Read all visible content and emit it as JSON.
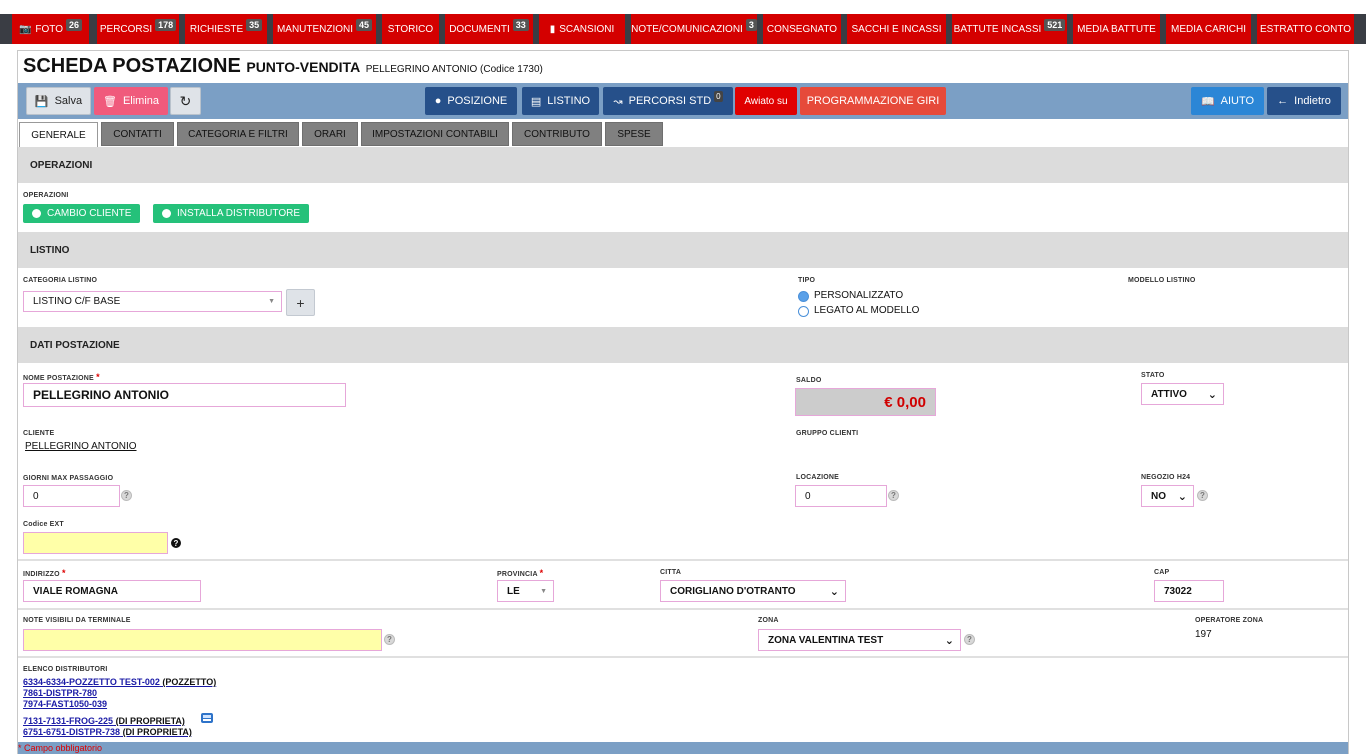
{
  "menu": [
    {
      "label": "FOTO",
      "badge": "26",
      "icon": "camera-icon"
    },
    {
      "label": "PERCORSI",
      "badge": "178"
    },
    {
      "label": "RICHIESTE",
      "badge": "35"
    },
    {
      "label": "MANUTENZIONI",
      "badge": "45"
    },
    {
      "label": "STORICO",
      "badge": ""
    },
    {
      "label": "DOCUMENTI",
      "badge": "33"
    },
    {
      "label": "SCANSIONI",
      "badge": "",
      "icon": "folder-icon"
    },
    {
      "label": "NOTE/COMUNICAZIONI",
      "badge": "3"
    },
    {
      "label": "CONSEGNATO",
      "badge": ""
    },
    {
      "label": "SACCHI E INCASSI",
      "badge": ""
    },
    {
      "label": "BATTUTE INCASSI",
      "badge": "521"
    },
    {
      "label": "MEDIA BATTUTE",
      "badge": ""
    },
    {
      "label": "MEDIA CARICHI",
      "badge": ""
    },
    {
      "label": "ESTRATTO CONTO",
      "badge": ""
    }
  ],
  "header": {
    "title": "SCHEDA POSTAZIONE",
    "subtitle": "PUNTO-VENDITA",
    "detail": "PELLEGRINO ANTONIO (Codice 1730)"
  },
  "toolbar": {
    "save": "Salva",
    "delete": "Elimina",
    "position": "POSIZIONE",
    "listino": "LISTINO",
    "percorsi_std": "PERCORSI STD",
    "percorsi_std_badge": "0",
    "awiato": "Awiato su",
    "programmazione": "PROGRAMMAZIONE GIRI",
    "help": "AIUTO",
    "back": "Indietro"
  },
  "tabs": [
    "GENERALE",
    "CONTATTI",
    "CATEGORIA E FILTRI",
    "ORARI",
    "IMPOSTAZIONI CONTABILI",
    "CONTRIBUTO",
    "SPESE"
  ],
  "operazioni": {
    "section": "OPERAZIONI",
    "label": "OPERAZIONI",
    "cambio_cliente": "CAMBIO CLIENTE",
    "installa": "INSTALLA DISTRIBUTORE"
  },
  "listino": {
    "section": "LISTINO",
    "categoria_label": "CATEGORIA LISTINO",
    "categoria_value": "LISTINO C/F BASE",
    "tipo_label": "TIPO",
    "tipo_opt1": "PERSONALIZZATO",
    "tipo_opt2": "LEGATO AL MODELLO",
    "modello_label": "MODELLO LISTINO"
  },
  "dati": {
    "section": "DATI POSTAZIONE",
    "nome_label": "NOME POSTAZIONE",
    "nome_value": "PELLEGRINO ANTONIO",
    "saldo_label": "SALDO",
    "saldo_value": "€ 0,00",
    "stato_label": "STATO",
    "stato_value": "ATTIVO",
    "cliente_label": "CLIENTE",
    "cliente_value": "PELLEGRINO ANTONIO",
    "gruppo_label": "GRUPPO CLIENTI",
    "giorni_label": "GIORNI MAX PASSAGGIO",
    "giorni_value": "0",
    "locazione_label": "LOCAZIONE",
    "locazione_value": "0",
    "negozio_label": "NEGOZIO H24",
    "negozio_value": "NO",
    "codice_label": "Codice EXT",
    "codice_value": ""
  },
  "indirizzo": {
    "indirizzo_label": "INDIRIZZO",
    "indirizzo_value": "VIALE ROMAGNA",
    "provincia_label": "PROVINCIA",
    "provincia_value": "LE",
    "citta_label": "CITTA",
    "citta_value": "CORIGLIANO D'OTRANTO",
    "cap_label": "CAP",
    "cap_value": "73022"
  },
  "note": {
    "note_label": "NOTE VISIBILI DA TERMINALE",
    "note_value": "",
    "zona_label": "ZONA",
    "zona_value": "ZONA VALENTINA TEST",
    "operatore_label": "OPERATORE ZONA",
    "operatore_value": "197"
  },
  "distributori": {
    "label": "ELENCO DISTRIBUTORI",
    "items": [
      {
        "code": "6334-6334-POZZETTO TEST-002",
        "tail": " (POZZETTO)"
      },
      {
        "code": "7861-DISTPR-780",
        "tail": ""
      },
      {
        "code": "7974-FAST1050-039",
        "tail": ""
      },
      {
        "code": "7131-7131-FROG-225",
        "tail": " (DI PROPRIETA)"
      },
      {
        "code": "6751-6751-DISTPR-738",
        "tail": " (DI PROPRIETA)"
      }
    ]
  },
  "footer_note": "* Campo obbligatorio",
  "help_glyph": "?",
  "required_mark": "*",
  "plus_glyph": "+",
  "colors": {
    "menu_red": "#d40000",
    "toolbar": "#7b9fc5",
    "green": "#25c17a",
    "saldo_red": "#d00000"
  }
}
